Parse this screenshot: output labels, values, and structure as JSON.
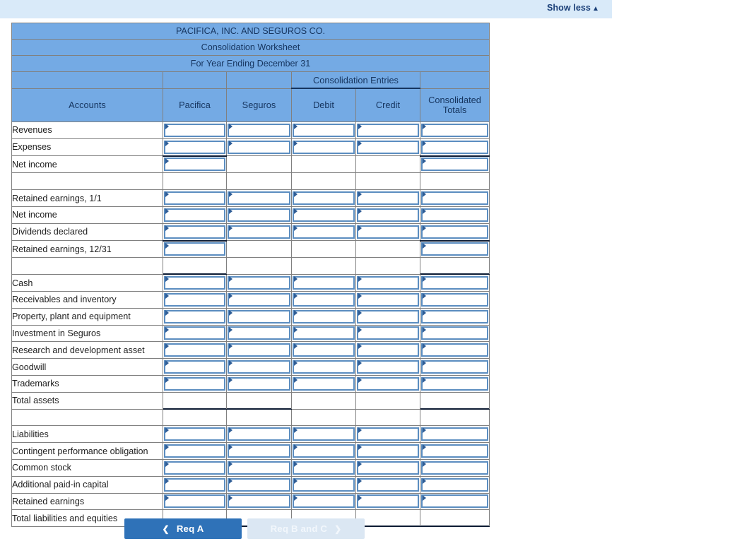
{
  "banner": {
    "show_less_label": "Show less",
    "caret_icon": "caret-up-icon"
  },
  "worksheet": {
    "title_line1": "PACIFICA, INC. AND SEGUROS CO.",
    "title_line2": "Consolidation Worksheet",
    "title_line3": "For Year Ending December 31",
    "group_header": "Consolidation Entries",
    "columns": [
      "Accounts",
      "Pacifica",
      "Seguros",
      "Debit",
      "Credit",
      "Consolidated Totals"
    ],
    "rows": [
      {
        "label": "Revenues",
        "inputs": [
          true,
          true,
          true,
          true,
          true
        ],
        "style": ""
      },
      {
        "label": "Expenses",
        "inputs": [
          true,
          true,
          true,
          true,
          true
        ],
        "style": ""
      },
      {
        "label": "Net income",
        "inputs": [
          true,
          false,
          false,
          false,
          true
        ],
        "style": "single-top"
      },
      {
        "label": "",
        "inputs": [
          false,
          false,
          false,
          false,
          false
        ],
        "style": "spacer"
      },
      {
        "label": "Retained earnings, 1/1",
        "inputs": [
          true,
          true,
          true,
          true,
          true
        ],
        "style": ""
      },
      {
        "label": "Net income",
        "inputs": [
          true,
          true,
          true,
          true,
          true
        ],
        "style": ""
      },
      {
        "label": "Dividends declared",
        "inputs": [
          true,
          true,
          true,
          true,
          true
        ],
        "style": ""
      },
      {
        "label": "Retained earnings, 12/31",
        "inputs": [
          true,
          false,
          false,
          false,
          true
        ],
        "style": "single-top"
      },
      {
        "label": "",
        "inputs": [
          false,
          false,
          false,
          false,
          false
        ],
        "style": "spacer-double"
      },
      {
        "label": "Cash",
        "inputs": [
          true,
          true,
          true,
          true,
          true
        ],
        "style": ""
      },
      {
        "label": "Receivables and inventory",
        "inputs": [
          true,
          true,
          true,
          true,
          true
        ],
        "style": ""
      },
      {
        "label": "Property, plant and equipment",
        "inputs": [
          true,
          true,
          true,
          true,
          true
        ],
        "style": ""
      },
      {
        "label": "Investment in Seguros",
        "inputs": [
          true,
          true,
          true,
          true,
          true
        ],
        "style": ""
      },
      {
        "label": "Research and development asset",
        "inputs": [
          true,
          true,
          true,
          true,
          true
        ],
        "style": ""
      },
      {
        "label": "Goodwill",
        "inputs": [
          true,
          true,
          true,
          true,
          true
        ],
        "style": ""
      },
      {
        "label": "Trademarks",
        "inputs": [
          true,
          true,
          true,
          true,
          true
        ],
        "style": ""
      },
      {
        "label": "Total assets",
        "inputs": [
          false,
          false,
          false,
          false,
          false
        ],
        "style": "totals-row"
      },
      {
        "label": "",
        "inputs": [
          false,
          false,
          false,
          false,
          false
        ],
        "style": "spacer"
      },
      {
        "label": "Liabilities",
        "inputs": [
          true,
          true,
          true,
          true,
          true
        ],
        "style": ""
      },
      {
        "label": "Contingent performance obligation",
        "inputs": [
          true,
          true,
          true,
          true,
          true
        ],
        "style": ""
      },
      {
        "label": "Common stock",
        "inputs": [
          true,
          true,
          true,
          true,
          true
        ],
        "style": ""
      },
      {
        "label": "Additional paid-in capital",
        "inputs": [
          true,
          true,
          true,
          true,
          true
        ],
        "style": ""
      },
      {
        "label": "Retained earnings",
        "inputs": [
          true,
          true,
          true,
          true,
          true
        ],
        "style": ""
      },
      {
        "label": "Total liabilities and equities",
        "inputs": [
          false,
          false,
          false,
          false,
          false
        ],
        "style": "grand-total-row"
      }
    ],
    "cell_placeholder": "",
    "cell_value": ""
  },
  "nav": {
    "prev_label": "Req A",
    "next_label": "Req B and C",
    "prev_icon": "chevron-left-icon",
    "next_icon": "chevron-right-icon"
  },
  "colors": {
    "header_blue": "#74aae4",
    "banner_blue": "#d9eaf9",
    "input_border": "#5b8dc0",
    "primary_button": "#2f72b8",
    "muted_button": "#dbe7f3",
    "text_navy": "#16355f"
  }
}
